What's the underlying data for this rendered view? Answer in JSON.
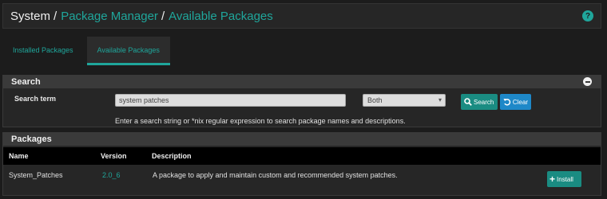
{
  "breadcrumb": {
    "root": "System",
    "sep": "/",
    "level1": "Package Manager",
    "level2": "Available Packages"
  },
  "help_icon": "?",
  "tabs": [
    {
      "label": "Installed Packages",
      "active": false
    },
    {
      "label": "Available Packages",
      "active": true
    }
  ],
  "search_panel": {
    "title": "Search",
    "term_label": "Search term",
    "term_value": "system patches",
    "select_value": "Both",
    "search_button": "Search",
    "clear_button": "Clear",
    "help_text": "Enter a search string or *nix regular expression to search package names and descriptions."
  },
  "packages_panel": {
    "title": "Packages",
    "columns": [
      "Name",
      "Version",
      "Description"
    ],
    "rows": [
      {
        "name": "System_Patches",
        "version": "2.0_6",
        "description": "A package to apply and maintain custom and recommended system patches.",
        "action": "Install"
      }
    ]
  },
  "colors": {
    "accent": "#1fa69b",
    "search_button": "#1a8c82",
    "clear_button": "#1e88c8",
    "background": "#1c1c1c"
  }
}
